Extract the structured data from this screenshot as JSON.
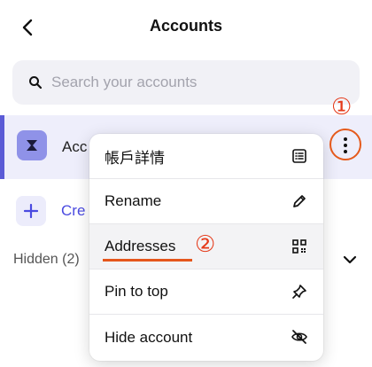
{
  "header": {
    "title": "Accounts"
  },
  "search": {
    "placeholder": "Search your accounts"
  },
  "account": {
    "name_visible": "Acc"
  },
  "create": {
    "label_visible": "Cre"
  },
  "hidden_section": {
    "label": "Hidden (2)"
  },
  "menu": {
    "items": [
      {
        "label": "帳戶詳情",
        "icon": "list-icon"
      },
      {
        "label": "Rename",
        "icon": "pencil-icon"
      },
      {
        "label": "Addresses",
        "icon": "qr-code-icon"
      },
      {
        "label": "Pin to top",
        "icon": "pin-icon"
      },
      {
        "label": "Hide account",
        "icon": "eye-off-icon"
      }
    ]
  },
  "annotations": {
    "step1": "①",
    "step2": "②"
  },
  "colors": {
    "accent": "#5b5bd6",
    "annotation": "#e5561c",
    "selected_row_bg": "#eeeefb"
  }
}
